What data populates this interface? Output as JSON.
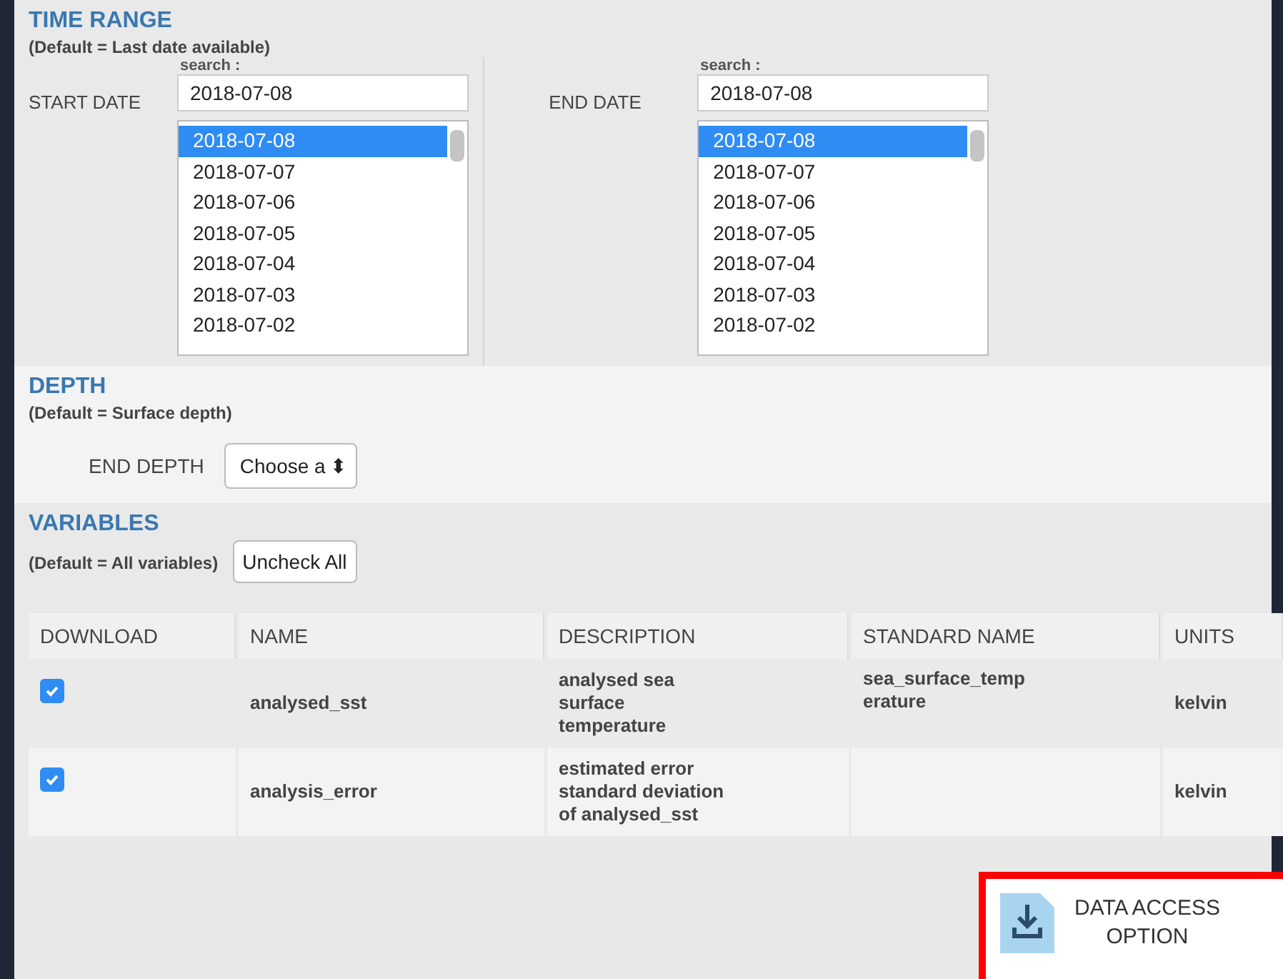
{
  "time_range": {
    "title": "TIME RANGE",
    "note": "(Default = Last date available)",
    "pickers": [
      {
        "label": "START DATE",
        "search_label": "search :",
        "value": "2018-07-08",
        "dates": [
          {
            "text": "2018-07-08",
            "selected": true
          },
          {
            "text": "2018-07-07",
            "selected": false
          },
          {
            "text": "2018-07-06",
            "selected": false
          },
          {
            "text": "2018-07-05",
            "selected": false
          },
          {
            "text": "2018-07-04",
            "selected": false
          },
          {
            "text": "2018-07-03",
            "selected": false
          },
          {
            "text": "2018-07-02",
            "selected": false
          }
        ]
      },
      {
        "label": "END DATE",
        "search_label": "search :",
        "value": "2018-07-08",
        "dates": [
          {
            "text": "2018-07-08",
            "selected": true
          },
          {
            "text": "2018-07-07",
            "selected": false
          },
          {
            "text": "2018-07-06",
            "selected": false
          },
          {
            "text": "2018-07-05",
            "selected": false
          },
          {
            "text": "2018-07-04",
            "selected": false
          },
          {
            "text": "2018-07-03",
            "selected": false
          },
          {
            "text": "2018-07-02",
            "selected": false
          }
        ]
      }
    ]
  },
  "depth": {
    "title": "DEPTH",
    "note": "(Default = Surface depth)",
    "label": "END DEPTH",
    "select": "Choose a",
    "select_arrow": "⬍"
  },
  "variables": {
    "title": "VARIABLES",
    "note": "(Default = All variables)",
    "button": "Uncheck All",
    "columns": [
      "DOWNLOAD",
      "NAME",
      "DESCRIPTION",
      "STANDARD NAME",
      "UNITS"
    ],
    "rows": [
      {
        "checked": true,
        "name": "analysed_sst",
        "description": "analysed sea\nsurface\ntemperature",
        "standard_name": "sea_surface_temp\nerature",
        "units": "kelvin"
      },
      {
        "checked": true,
        "name": "analysis_error",
        "description": "estimated error\nstandard deviation\nof analysed_sst",
        "standard_name": "",
        "units": "kelvin"
      }
    ]
  },
  "action": {
    "label": "DATA ACCESS\nOPTION"
  }
}
